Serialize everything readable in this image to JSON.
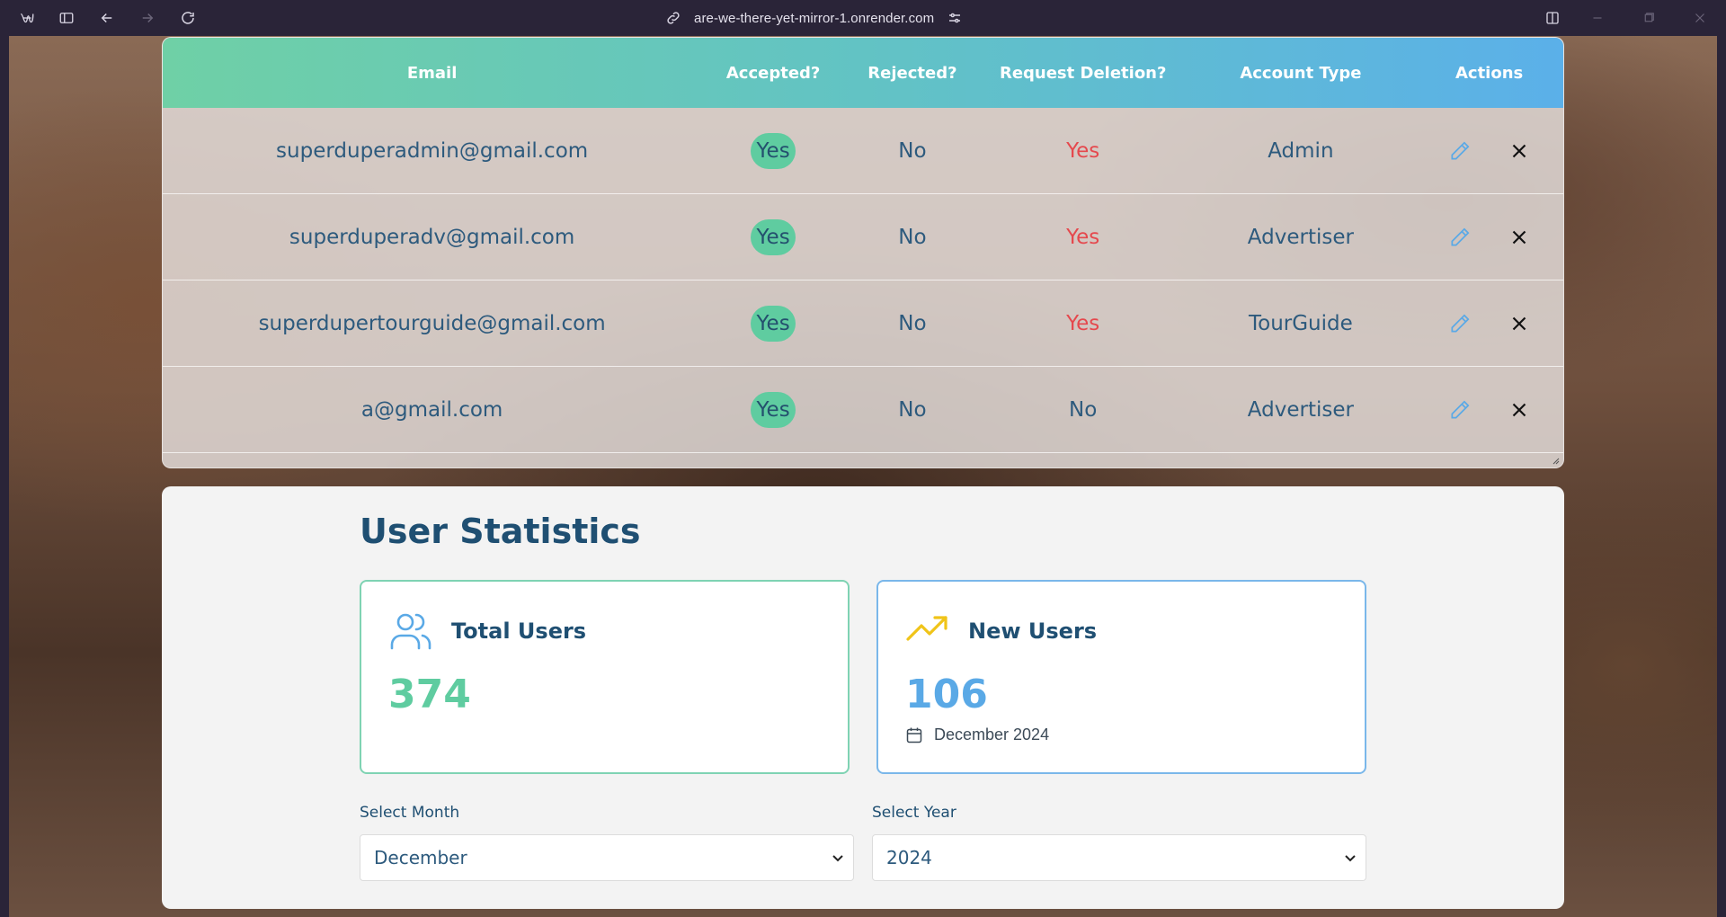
{
  "browser": {
    "url": "are-we-there-yet-mirror-1.onrender.com"
  },
  "table": {
    "headers": {
      "email": "Email",
      "accepted": "Accepted?",
      "rejected": "Rejected?",
      "deletion": "Request Deletion?",
      "type": "Account Type",
      "actions": "Actions"
    },
    "rows": [
      {
        "email": "superduperadmin@gmail.com",
        "accepted": "Yes",
        "rejected": "No",
        "deletion": "Yes",
        "type": "Admin"
      },
      {
        "email": "superduperadv@gmail.com",
        "accepted": "Yes",
        "rejected": "No",
        "deletion": "Yes",
        "type": "Advertiser"
      },
      {
        "email": "superdupertourguide@gmail.com",
        "accepted": "Yes",
        "rejected": "No",
        "deletion": "Yes",
        "type": "TourGuide"
      },
      {
        "email": "a@gmail.com",
        "accepted": "Yes",
        "rejected": "No",
        "deletion": "No",
        "type": "Advertiser"
      }
    ]
  },
  "stats": {
    "title": "User Statistics",
    "total": {
      "label": "Total Users",
      "value": "374"
    },
    "new": {
      "label": "New Users",
      "value": "106",
      "period": "December 2024"
    },
    "month": {
      "label": "Select Month",
      "value": "December"
    },
    "year": {
      "label": "Select Year",
      "value": "2024"
    }
  },
  "colors": {
    "accent_green": "#5fcca0",
    "accent_blue": "#5aa9e6",
    "deletion_red": "#e5484d",
    "heading_navy": "#1f4f72"
  },
  "icons": {
    "total_users": "users-icon",
    "new_users": "trending-up-icon",
    "period": "calendar-icon",
    "edit": "pencil-icon",
    "delete": "close-icon"
  }
}
